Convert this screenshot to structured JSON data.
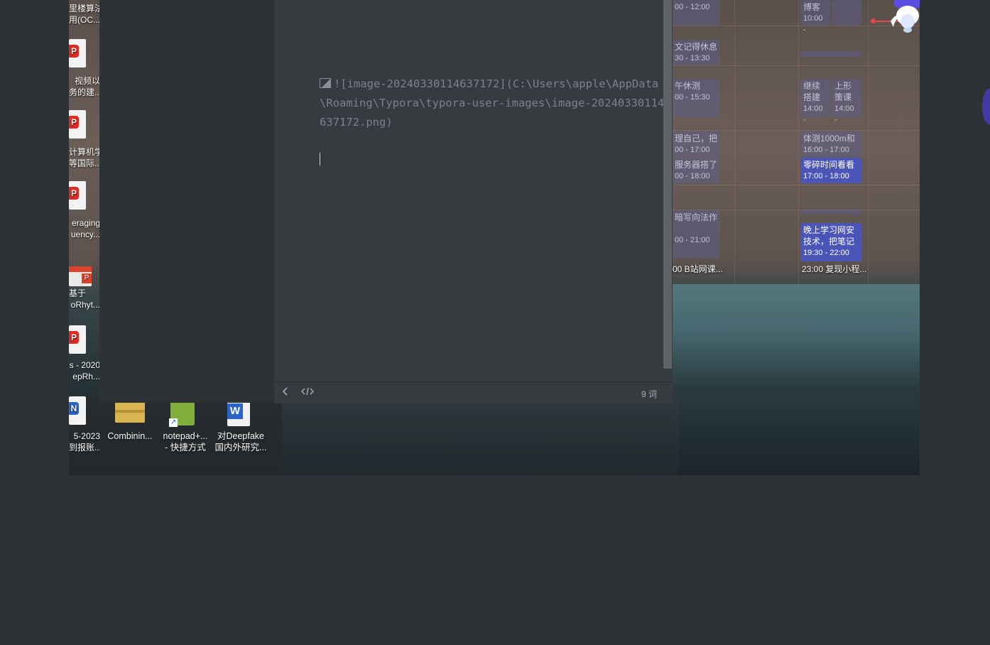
{
  "desktop": {
    "left_icons": [
      {
        "label_lines": [
          "里楼算法",
          "用(OC..."
        ],
        "type": "document"
      },
      {
        "label_lines": [
          "视频以",
          "务的建..."
        ],
        "type": "pdf"
      },
      {
        "label_lines": [
          "计算机学",
          "等国际..."
        ],
        "type": "pdf"
      },
      {
        "label_lines": [
          "eraging",
          "uency..."
        ],
        "type": "pdf"
      },
      {
        "label_lines": [
          "基于",
          "oRhyt..."
        ],
        "type": "ppt"
      },
      {
        "label_lines": [
          "s - 2020",
          "epRh..."
        ],
        "type": "pdf"
      },
      {
        "label_lines": [
          "5-2023",
          "到报账..."
        ],
        "type": "word"
      }
    ],
    "bottom_icons": [
      {
        "label_lines": [
          "Combinin..."
        ],
        "type": "archive"
      },
      {
        "label_lines": [
          "notepad+...",
          "- 快捷方式"
        ],
        "type": "shortcut"
      },
      {
        "label_lines": [
          "对Deepfake",
          "国内外研究..."
        ],
        "type": "word"
      }
    ]
  },
  "editor": {
    "markdown_text": "![image-20240330114637172](C:\\Users\\apple\\AppData\\Roaming\\Typora\\typora-user-images\\image-20240330114637172.png)",
    "word_count": "9 词",
    "footer": {
      "back_icon": "chevron-left-icon",
      "source_icon": "code-icon"
    }
  },
  "calendar": {
    "events": [
      {
        "title": "",
        "time": "00 - 12:00",
        "style": "dim"
      },
      {
        "title": "博客",
        "time": "10:00 -",
        "style": "dim"
      },
      {
        "title": "文记得休息",
        "time": "30 - 13:30",
        "style": "dim"
      },
      {
        "title": "午休测",
        "time": "00 - 15:30",
        "style": "dim"
      },
      {
        "title": "继续搭建",
        "time": "14:00 -",
        "style": "dim"
      },
      {
        "title": "上形策课",
        "time": "14:00 -",
        "style": "dim"
      },
      {
        "title": "理自己，把",
        "time": "00 - 17:00",
        "style": "dim"
      },
      {
        "title": "体测1000m和",
        "time": "16:00 - 17:00",
        "style": "dim"
      },
      {
        "title": "服务器搭了",
        "time": "00 - 18:00",
        "style": "dim"
      },
      {
        "title": "零碎时间看看",
        "time": "17:00 - 18:00",
        "style": "bright"
      },
      {
        "title": "暗写向法作",
        "time": "00 - 21:00",
        "style": "dim"
      },
      {
        "title": "晚上学习网安技术，把笔记",
        "time": "19:30 - 22:00",
        "style": "bright"
      }
    ],
    "bottom_items": [
      "00 B站网课...",
      "23:00 复现小程..."
    ]
  }
}
